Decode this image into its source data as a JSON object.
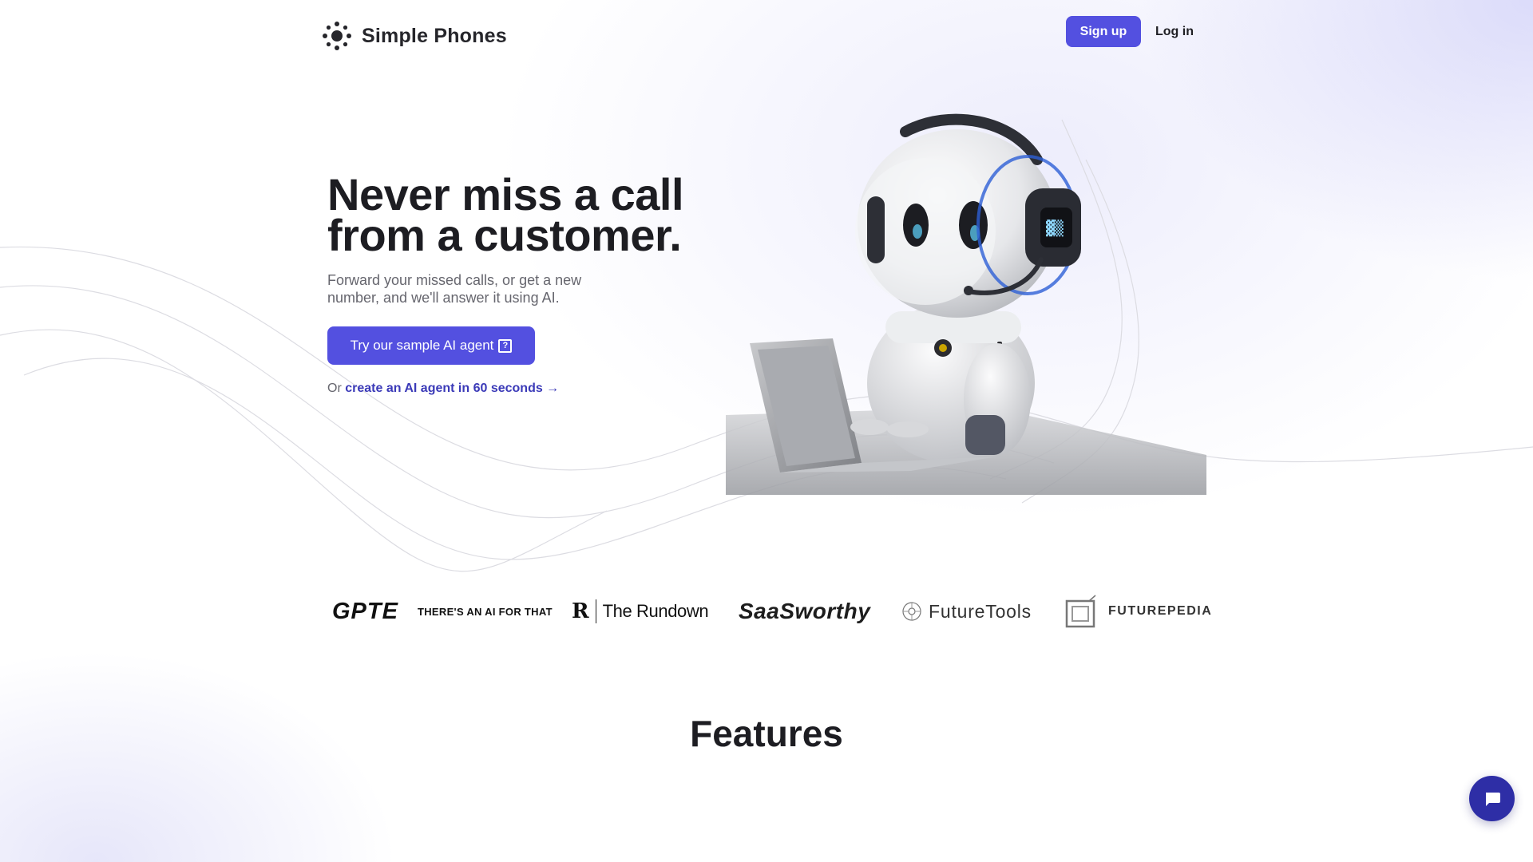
{
  "header": {
    "brand_name": "Simple Phones",
    "logo_icon": "sun-burst-icon",
    "signup_label": "Sign up",
    "login_label": "Log in"
  },
  "hero": {
    "title": "Never miss a call from a customer.",
    "subtitle": "Forward your missed calls, or get a new number, and we'll answer it using AI.",
    "cta_label": "Try our sample AI agent",
    "cta_icon": "question-box-icon",
    "alt_prefix": "Or",
    "alt_link": "create an AI agent in 60 seconds →"
  },
  "featured_logos": {
    "items": [
      {
        "text": "GPTE"
      },
      {
        "text": "THERE'S AN AI FOR THAT"
      },
      {
        "mark": "R",
        "text": "The Rundown"
      },
      {
        "text": "SaaSworthy"
      },
      {
        "text": "FutureTools"
      },
      {
        "text": "FUTUREPEDIA"
      }
    ]
  },
  "features": {
    "heading": "Features"
  },
  "chat": {
    "icon": "chat-bubble-icon"
  },
  "colors": {
    "accent": "#5350e0",
    "link": "#3b3ab8",
    "chat_button": "#2e2ea6"
  }
}
